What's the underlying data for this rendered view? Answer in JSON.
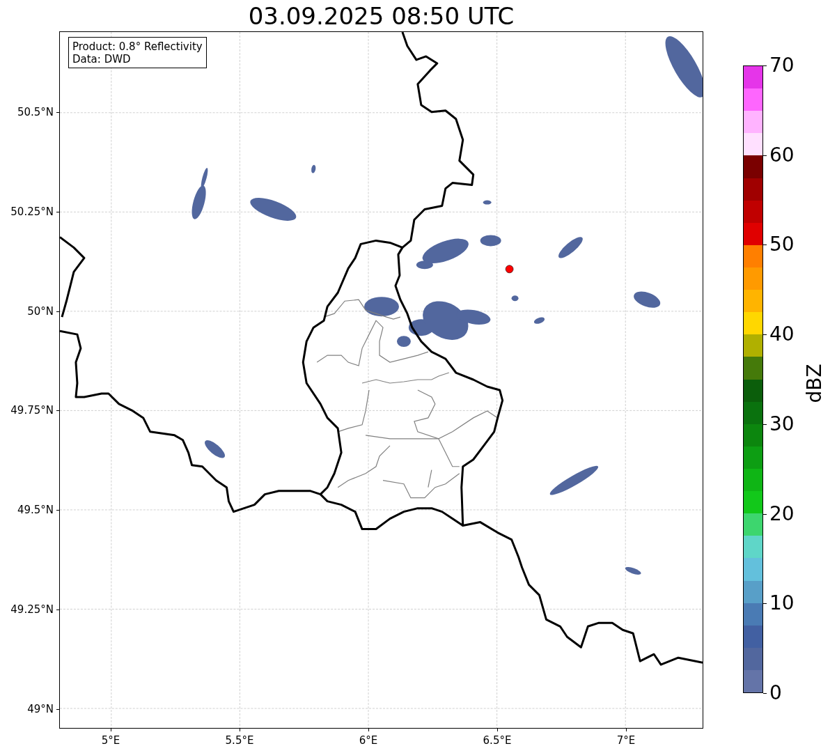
{
  "map": {
    "title": "03.09.2025 08:50 UTC",
    "xticks": [
      "5°E",
      "5.5°E",
      "6°E",
      "6.5°E",
      "7°E"
    ],
    "yticks": [
      "50.5°N",
      "50.25°N",
      "50°N",
      "49.75°N",
      "49.5°N",
      "49.25°N",
      "49°N"
    ]
  },
  "annotation": [
    "Product: 0.8° Reflectivity",
    "Data: DWD"
  ],
  "colorbar": {
    "label": "dBZ",
    "ticks": [
      "70",
      "60",
      "50",
      "40",
      "30",
      "20",
      "10",
      "0"
    ],
    "segments": [
      {
        "color": "#e535e9"
      },
      {
        "color": "#fe66fe"
      },
      {
        "color": "#ffb3ff"
      },
      {
        "color": "#ffe0ff"
      },
      {
        "color": "#7a0000"
      },
      {
        "color": "#a00000"
      },
      {
        "color": "#c00000"
      },
      {
        "color": "#e00000"
      },
      {
        "color": "#ff7f00"
      },
      {
        "color": "#ff9a00"
      },
      {
        "color": "#ffb400"
      },
      {
        "color": "#ffd700"
      },
      {
        "color": "#b0b000"
      },
      {
        "color": "#457a0a"
      },
      {
        "color": "#0b5e0b"
      },
      {
        "color": "#0a720e"
      },
      {
        "color": "#0c860e"
      },
      {
        "color": "#0d9e13"
      },
      {
        "color": "#0fb515"
      },
      {
        "color": "#12c81a"
      },
      {
        "color": "#3dd66e"
      },
      {
        "color": "#5fd6c8"
      },
      {
        "color": "#63c0dc"
      },
      {
        "color": "#589fc8"
      },
      {
        "color": "#4a7bb4"
      },
      {
        "color": "#4260a2"
      },
      {
        "color": "#52679e"
      },
      {
        "color": "#6474a8"
      }
    ]
  }
}
